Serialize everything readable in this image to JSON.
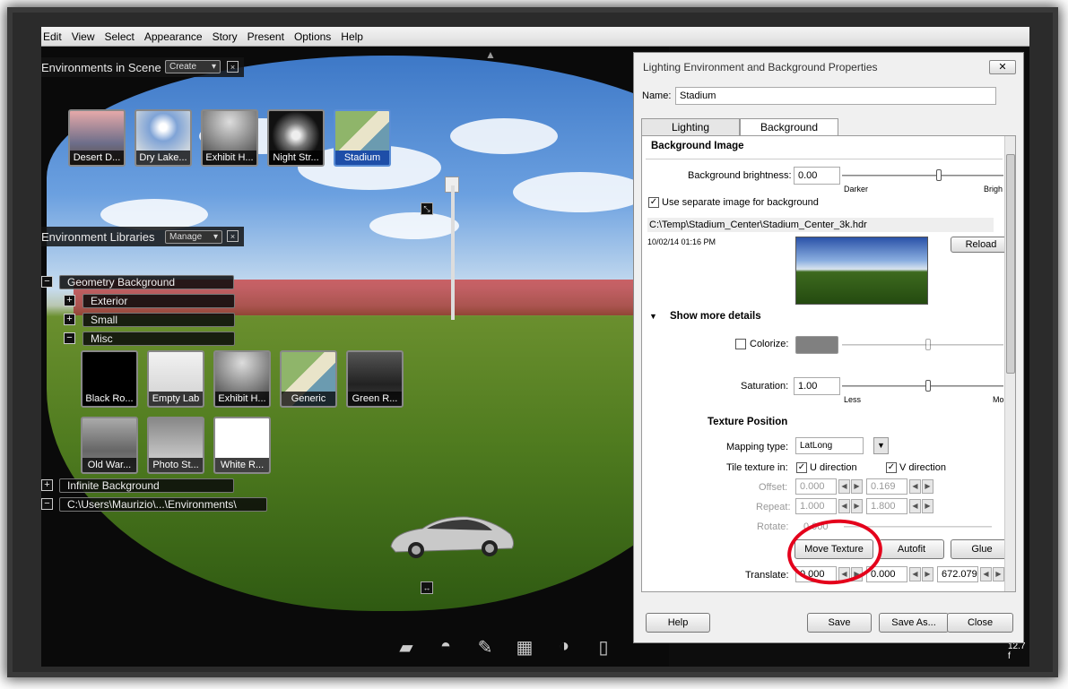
{
  "menu": [
    "Edit",
    "View",
    "Select",
    "Appearance",
    "Story",
    "Present",
    "Options",
    "Help"
  ],
  "scene_panel": {
    "title": "Environments in Scene",
    "create_label": "Create",
    "close": "×",
    "thumbs": [
      "Desert D...",
      "Dry Lake...",
      "Exhibit H...",
      "Night Str...",
      "Stadium"
    ]
  },
  "libraries_panel": {
    "title": "Environment Libraries",
    "manage_label": "Manage",
    "close": "×",
    "tree": [
      {
        "pm": "−",
        "label": "Geometry Background"
      },
      {
        "pm": "+",
        "label": "Exterior"
      },
      {
        "pm": "+",
        "label": "Small"
      },
      {
        "pm": "−",
        "label": "Misc"
      },
      {
        "pm": "+",
        "label": "Infinite Background"
      },
      {
        "pm": "−",
        "label": "C:\\Users\\Maurizio\\...\\Environments\\"
      }
    ],
    "misc_thumbs": [
      "Black Ro...",
      "Empty Lab",
      "Exhibit H...",
      "Generic",
      "Green R...",
      "Old War...",
      "Photo St...",
      "White R..."
    ]
  },
  "dialog": {
    "title": "Lighting Environment and Background Properties",
    "close": "✕",
    "name_label": "Name:",
    "name_value": "Stadium",
    "tabs": [
      "Lighting",
      "Background"
    ],
    "section": "Background Image",
    "brightness_label": "Background brightness:",
    "brightness_value": "0.00",
    "brightness_fraction": 0.6,
    "darker": "Darker",
    "brighter": "Brigh",
    "separate_label": "Use separate image for background",
    "separate_checked": true,
    "path": "C:\\Temp\\Stadium_Center\\Stadium_Center_3k.hdr",
    "timestamp": "10/02/14 01:16 PM",
    "reload": "Reload",
    "more_details": "Show more details",
    "colorize_label": "Colorize:",
    "colorize_color": "#808080",
    "saturation_label": "Saturation:",
    "saturation_value": "1.00",
    "less": "Less",
    "more": "Mo",
    "texture_section": "Texture Position",
    "mapping_label": "Mapping type:",
    "mapping_value": "LatLong",
    "tile_label": "Tile texture in:",
    "u_label": "U direction",
    "v_label": "V direction",
    "offset_label": "Offset:",
    "offset_u": "0.000",
    "offset_v": "0.169",
    "repeat_label": "Repeat:",
    "repeat_u": "1.000",
    "repeat_v": "1.800",
    "rotate_label": "Rotate:",
    "rotate_value": "0.000",
    "move_texture": "Move Texture",
    "autofit": "Autofit",
    "glue": "Glue",
    "translate_label": "Translate:",
    "translate_x": "0.000",
    "translate_y": "0.000",
    "translate_z": "672.079",
    "help": "Help",
    "save": "Save",
    "save_as": "Save As...",
    "close_btn": "Close"
  },
  "fps": "12.7 f",
  "accent": "#1e4ea8",
  "annotation_color": "#e4001b"
}
